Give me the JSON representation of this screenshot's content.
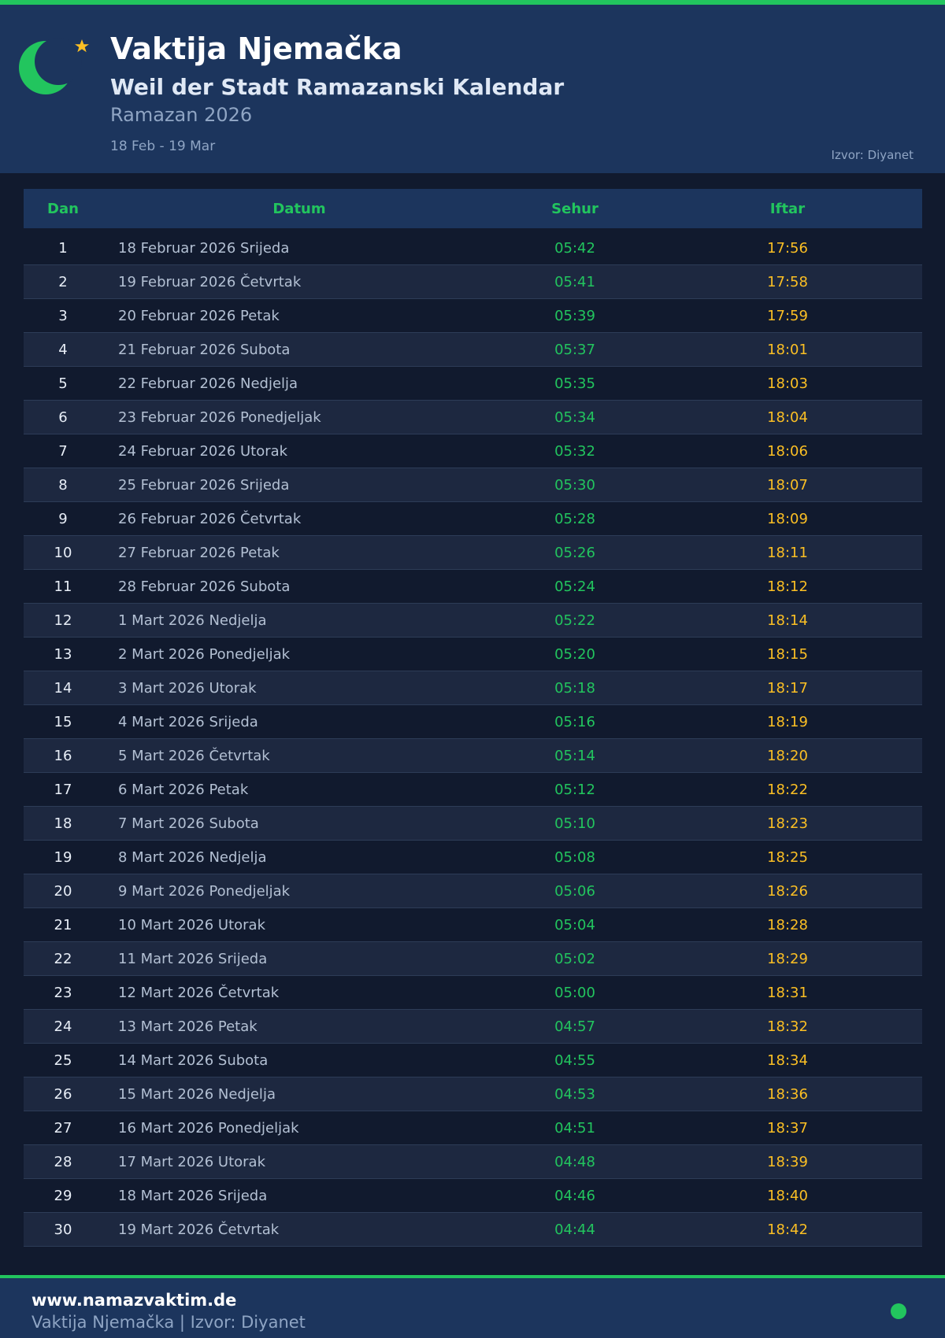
{
  "header": {
    "title": "Vaktija Njemačka",
    "subtitle": "Weil der Stadt Ramazanski Kalendar",
    "ramadan_year": "Ramazan 2026",
    "date_range": "18 Feb - 19 Mar",
    "source": "Izvor: Diyanet",
    "logo_icons": [
      "crescent-moon-icon",
      "star-icon"
    ]
  },
  "colors": {
    "accent_green": "#22c55e",
    "iftar_gold": "#fbbf24",
    "header_bg": "#1c355d",
    "page_bg": "#111a2e"
  },
  "table": {
    "columns": [
      "Dan",
      "Datum",
      "Sehur",
      "Iftar"
    ],
    "rows": [
      {
        "dan": "1",
        "datum": "18 Februar 2026 Srijeda",
        "sehur": "05:42",
        "iftar": "17:56"
      },
      {
        "dan": "2",
        "datum": "19 Februar 2026 Četvrtak",
        "sehur": "05:41",
        "iftar": "17:58"
      },
      {
        "dan": "3",
        "datum": "20 Februar 2026 Petak",
        "sehur": "05:39",
        "iftar": "17:59"
      },
      {
        "dan": "4",
        "datum": "21 Februar 2026 Subota",
        "sehur": "05:37",
        "iftar": "18:01"
      },
      {
        "dan": "5",
        "datum": "22 Februar 2026 Nedjelja",
        "sehur": "05:35",
        "iftar": "18:03"
      },
      {
        "dan": "6",
        "datum": "23 Februar 2026 Ponedjeljak",
        "sehur": "05:34",
        "iftar": "18:04"
      },
      {
        "dan": "7",
        "datum": "24 Februar 2026 Utorak",
        "sehur": "05:32",
        "iftar": "18:06"
      },
      {
        "dan": "8",
        "datum": "25 Februar 2026 Srijeda",
        "sehur": "05:30",
        "iftar": "18:07"
      },
      {
        "dan": "9",
        "datum": "26 Februar 2026 Četvrtak",
        "sehur": "05:28",
        "iftar": "18:09"
      },
      {
        "dan": "10",
        "datum": "27 Februar 2026 Petak",
        "sehur": "05:26",
        "iftar": "18:11"
      },
      {
        "dan": "11",
        "datum": "28 Februar 2026 Subota",
        "sehur": "05:24",
        "iftar": "18:12"
      },
      {
        "dan": "12",
        "datum": "1 Mart 2026 Nedjelja",
        "sehur": "05:22",
        "iftar": "18:14"
      },
      {
        "dan": "13",
        "datum": "2 Mart 2026 Ponedjeljak",
        "sehur": "05:20",
        "iftar": "18:15"
      },
      {
        "dan": "14",
        "datum": "3 Mart 2026 Utorak",
        "sehur": "05:18",
        "iftar": "18:17"
      },
      {
        "dan": "15",
        "datum": "4 Mart 2026 Srijeda",
        "sehur": "05:16",
        "iftar": "18:19"
      },
      {
        "dan": "16",
        "datum": "5 Mart 2026 Četvrtak",
        "sehur": "05:14",
        "iftar": "18:20"
      },
      {
        "dan": "17",
        "datum": "6 Mart 2026 Petak",
        "sehur": "05:12",
        "iftar": "18:22"
      },
      {
        "dan": "18",
        "datum": "7 Mart 2026 Subota",
        "sehur": "05:10",
        "iftar": "18:23"
      },
      {
        "dan": "19",
        "datum": "8 Mart 2026 Nedjelja",
        "sehur": "05:08",
        "iftar": "18:25"
      },
      {
        "dan": "20",
        "datum": "9 Mart 2026 Ponedjeljak",
        "sehur": "05:06",
        "iftar": "18:26"
      },
      {
        "dan": "21",
        "datum": "10 Mart 2026 Utorak",
        "sehur": "05:04",
        "iftar": "18:28"
      },
      {
        "dan": "22",
        "datum": "11 Mart 2026 Srijeda",
        "sehur": "05:02",
        "iftar": "18:29"
      },
      {
        "dan": "23",
        "datum": "12 Mart 2026 Četvrtak",
        "sehur": "05:00",
        "iftar": "18:31"
      },
      {
        "dan": "24",
        "datum": "13 Mart 2026 Petak",
        "sehur": "04:57",
        "iftar": "18:32"
      },
      {
        "dan": "25",
        "datum": "14 Mart 2026 Subota",
        "sehur": "04:55",
        "iftar": "18:34"
      },
      {
        "dan": "26",
        "datum": "15 Mart 2026 Nedjelja",
        "sehur": "04:53",
        "iftar": "18:36"
      },
      {
        "dan": "27",
        "datum": "16 Mart 2026 Ponedjeljak",
        "sehur": "04:51",
        "iftar": "18:37"
      },
      {
        "dan": "28",
        "datum": "17 Mart 2026 Utorak",
        "sehur": "04:48",
        "iftar": "18:39"
      },
      {
        "dan": "29",
        "datum": "18 Mart 2026 Srijeda",
        "sehur": "04:46",
        "iftar": "18:40"
      },
      {
        "dan": "30",
        "datum": "19 Mart 2026 Četvrtak",
        "sehur": "04:44",
        "iftar": "18:42"
      }
    ]
  },
  "footer": {
    "url": "www.namazvaktim.de",
    "subtext": "Vaktija Njemačka | Izvor: Diyanet",
    "status_dot_icon": "green-dot-icon"
  }
}
